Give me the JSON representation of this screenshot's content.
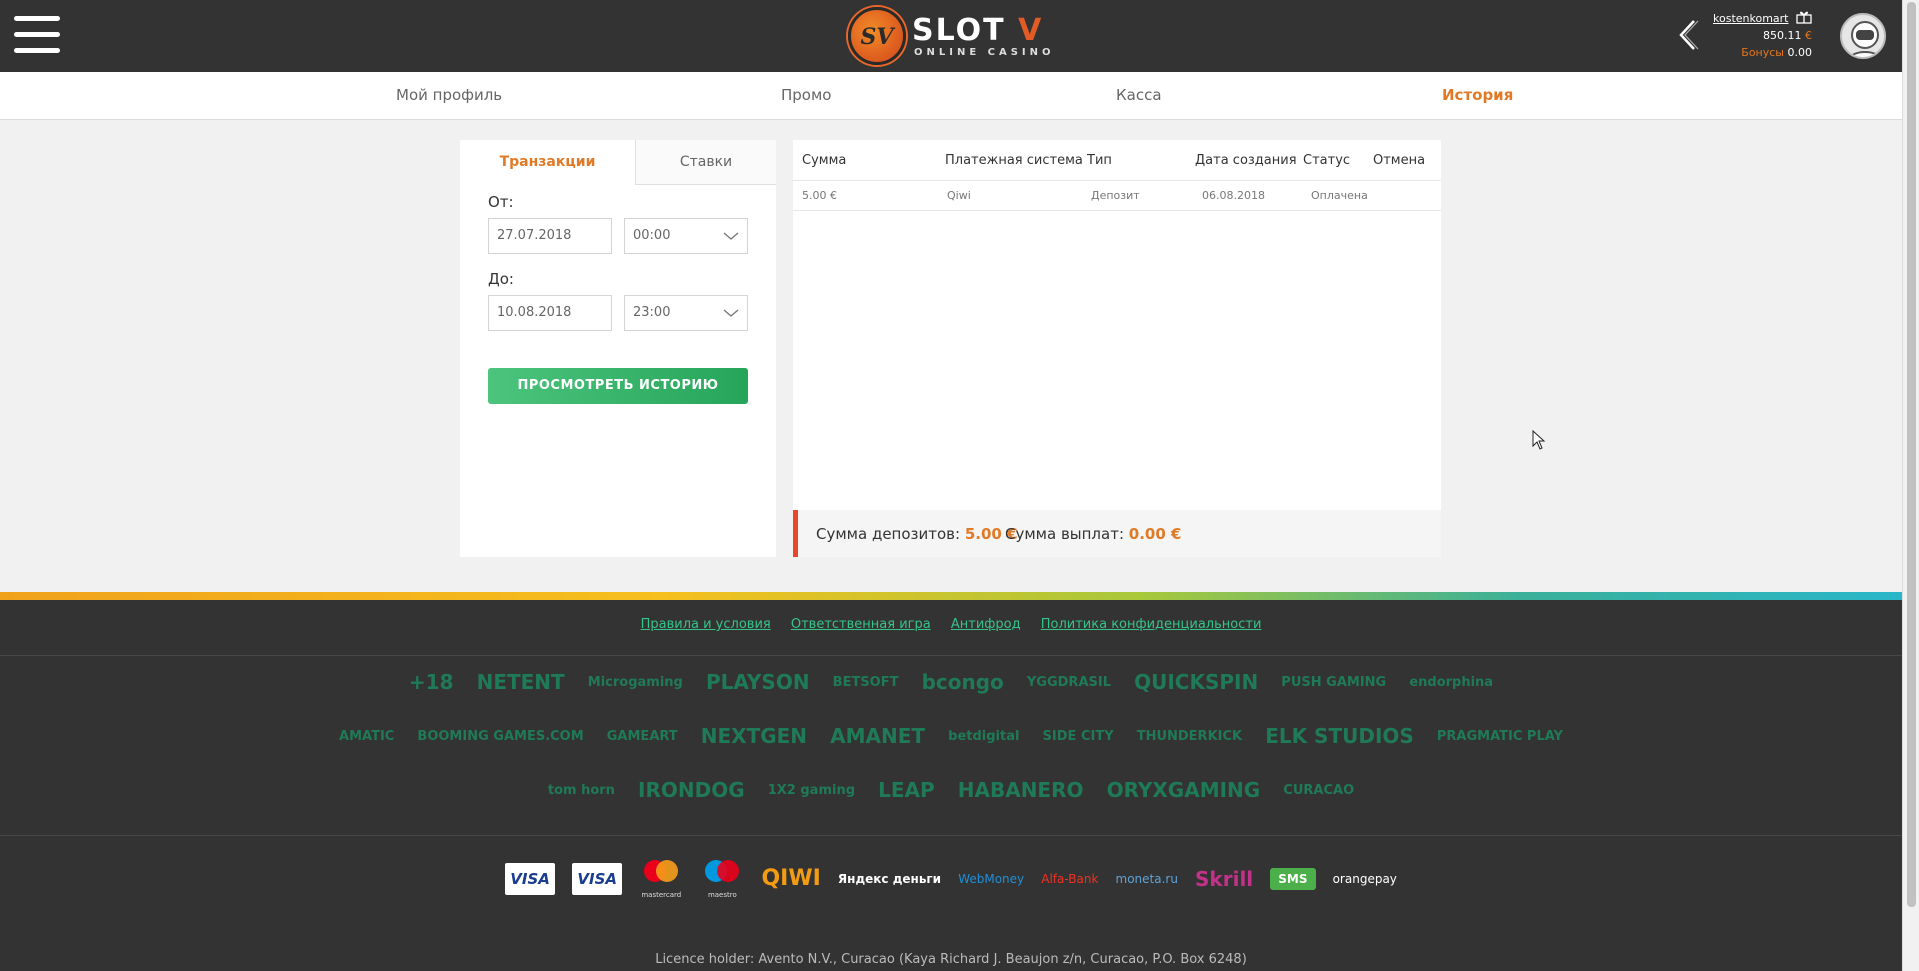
{
  "header": {
    "logo_mark": "SV",
    "logo_word_a": "SLOT ",
    "logo_word_b": "V",
    "logo_sub": "ONLINE CASINO",
    "username": "kostenkomart",
    "balance": "850.11",
    "balance_currency": "€",
    "bonus_label": "Бонусы",
    "bonus_value": "0.00"
  },
  "nav": {
    "profile": "Мой профиль",
    "promo": "Промо",
    "cashier": "Касса",
    "history": "История"
  },
  "filter": {
    "tab_transactions": "Транзакции",
    "tab_bets": "Ставки",
    "from_label": "От:",
    "from_date": "27.07.2018",
    "from_time": "00:00",
    "to_label": "До:",
    "to_date": "10.08.2018",
    "to_time": "23:00",
    "submit": "ПРОСМОТРЕТЬ ИСТОРИЮ"
  },
  "table": {
    "columns": [
      "Сумма",
      "Платежная система",
      "Тип",
      "Дата создания",
      "Статус",
      "Отмена"
    ],
    "rows": [
      [
        "5.00 €",
        "Qiwi",
        "Депозит",
        "06.08.2018",
        "Оплачена",
        ""
      ]
    ],
    "deposits_label": "Сумма депозитов:",
    "deposits_value": "5.00 €",
    "payouts_label": "Сумма выплат:",
    "payouts_value": "0.00 €"
  },
  "footer": {
    "links": [
      "Правила и условия",
      "Ответственная игра",
      "Антифрод",
      "Политика конфиденциальности"
    ],
    "providers_row1": [
      "+18",
      "NETENT",
      "Microgaming",
      "PLAYSON",
      "BETSOFT",
      "bcongo",
      "YGGDRASIL",
      "QUICKSPIN",
      "PUSH GAMING",
      "endorphina"
    ],
    "providers_row2": [
      "AMATIC",
      "BOOMING GAMES.COM",
      "GAMEART",
      "NEXTGEN",
      "AMANET",
      "betdigital",
      "SIDE CITY",
      "THUNDERKICK",
      "ELK STUDIOS",
      "PRAGMATIC PLAY"
    ],
    "providers_row3": [
      "tom horn",
      "IRONDOG",
      "1X2 gaming",
      "LEAP",
      "HABANERO",
      "ORYXGAMING",
      "CURACAO"
    ],
    "payments": [
      "VISA",
      "VISA",
      "mastercard",
      "maestro",
      "QIWI",
      "Яндекс деньги",
      "WebMoney",
      "Alfa-Bank",
      "moneta.ru",
      "Skrill",
      "SMS",
      "orangepay"
    ],
    "licence": "Licence holder: Avento N.V., Curacao (Kaya Richard J. Beaujon z/n, Curacao, P.O. Box 6248)"
  },
  "colors": {
    "accent": "#e07a26",
    "header_bg": "#333333",
    "green": "#26a55a",
    "footer_link": "#36c48a"
  }
}
